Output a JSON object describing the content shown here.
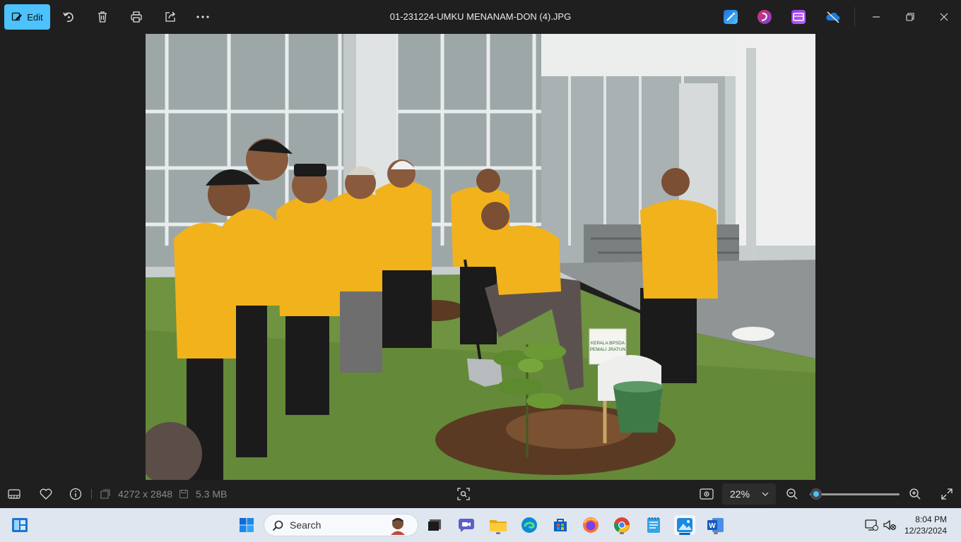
{
  "toolbar": {
    "edit_label": "Edit",
    "file_title": "01-231224-UMKU MENANAM-DON (4).JPG"
  },
  "photo": {
    "sign_line1": "KEPALA BPSDA",
    "sign_line2": "PEMALI JRATUN"
  },
  "status": {
    "dimensions": "4272 x 2848",
    "file_size": "5.3 MB",
    "zoom": "22%",
    "zoom_level": 0.22
  },
  "taskbar": {
    "search_label": "Search",
    "time": "8:04 PM",
    "date": "12/23/2024"
  },
  "colors": {
    "accent": "#4cc2ff",
    "shirt": "#f2b21c",
    "taskbar": "#dfe6f0"
  }
}
